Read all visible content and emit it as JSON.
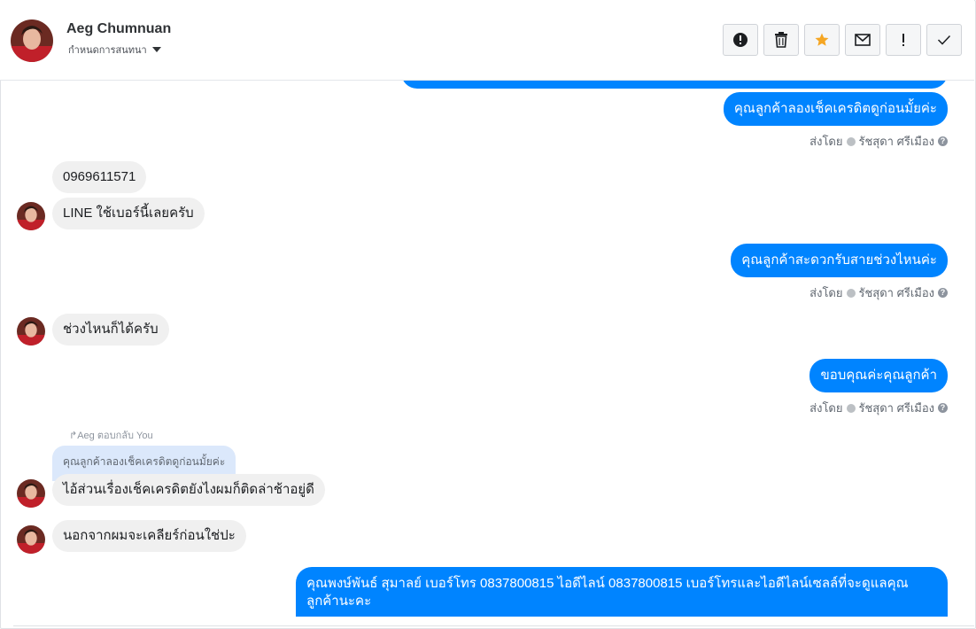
{
  "header": {
    "contact_name": "Aeg Chumnuan",
    "subtitle": "กำหนดการสนทนา",
    "toolbar": [
      {
        "icon": "alert-circle-icon",
        "label": "!"
      },
      {
        "icon": "trash-icon"
      },
      {
        "icon": "star-icon",
        "color": "#f5a623"
      },
      {
        "icon": "envelope-icon"
      },
      {
        "icon": "exclamation-icon",
        "label": "!"
      },
      {
        "icon": "check-icon"
      }
    ]
  },
  "messages": {
    "out1": "คุณลูกค้าลองเช็คเครดิตดูก่อนมั้ยค่ะ",
    "sent_by_label": "ส่งโดย",
    "agent_name": "รัชสุดา ศรีเมือง",
    "help_glyph": "?",
    "in1": "0969611571",
    "in2": "LINE ใช้เบอร์นี้เลยครับ",
    "out2": "คุณลูกค้าสะดวกรับสายช่วงไหนค่ะ",
    "in3": "ช่วงไหนก็ได้ครับ",
    "out3": "ขอบคุณค่ะคุณลูกค้า",
    "reply_label": "↱Aeg ตอบกลับ You",
    "quoted": "คุณลูกค้าลองเช็คเครดิตดูก่อนมั้ยค่ะ",
    "in4": "ไอ้ส่วนเรื่องเช็คเครดิตยังไงผมก็ติดล่าช้าอยู่ดี",
    "in5": "นอกจากผมจะเคลียร์ก่อนใช่ปะ",
    "out4": "คุณพงษ์พันธ์ สุมาลย์      เบอร์โทร 0837800815  ไอดีไลน์ 0837800815   เบอร์โทรและไอดีไลน์เซลล์ที่จะดูแลคุณลูกค้านะคะ"
  },
  "colors": {
    "outgoing_bubble": "#0084ff",
    "incoming_bubble": "#f0f0f0",
    "quote_bubble": "#dbe8fb"
  }
}
